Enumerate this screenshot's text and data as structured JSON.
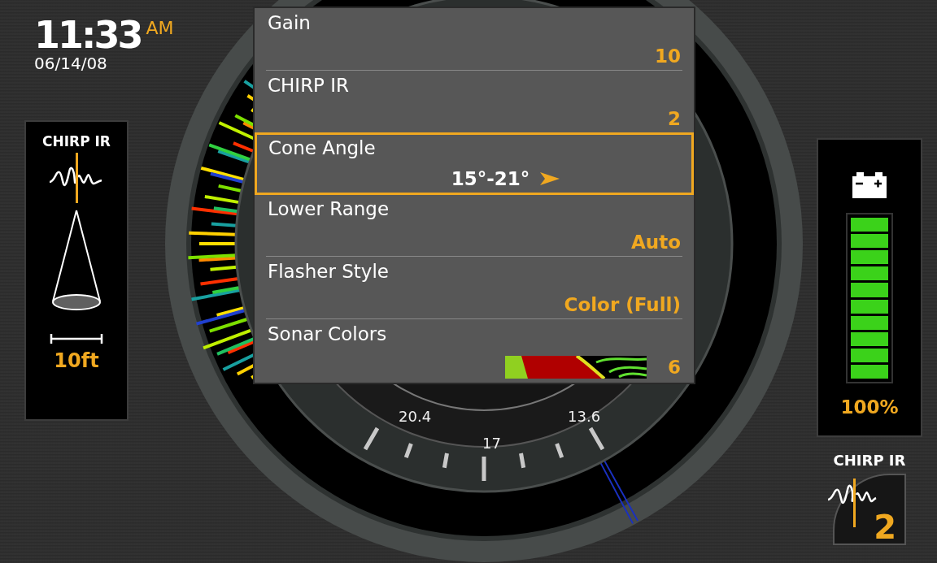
{
  "clock": {
    "time": "11:33",
    "meridiem": "AM",
    "date": "06/14/08"
  },
  "left_panel": {
    "title": "CHIRP IR",
    "width": "10ft"
  },
  "dial": {
    "labels": [
      "20.4",
      "17",
      "13.6"
    ]
  },
  "menu": {
    "items": [
      {
        "label": "Gain",
        "value": "10",
        "kind": "text",
        "selected": false
      },
      {
        "label": "CHIRP IR",
        "value": "2",
        "kind": "text",
        "selected": false
      },
      {
        "label": "Cone Angle",
        "value": "15°-21°",
        "kind": "text",
        "selected": true
      },
      {
        "label": "Lower Range",
        "value": "Auto",
        "kind": "text",
        "selected": false
      },
      {
        "label": "Flasher Style",
        "value": "Color (Full)",
        "kind": "text",
        "selected": false
      },
      {
        "label": "Sonar Colors",
        "value": "6",
        "kind": "palette",
        "selected": false
      }
    ]
  },
  "battery": {
    "level": 1.0,
    "reading": "100%"
  },
  "chirp_badge": {
    "title": "CHIRP IR",
    "value": "2"
  }
}
